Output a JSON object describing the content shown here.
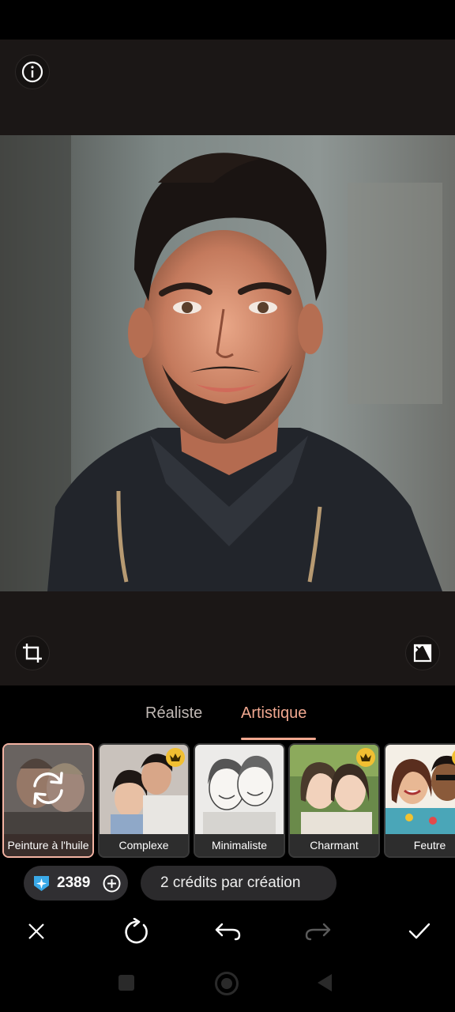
{
  "tabs": [
    {
      "label": "Réaliste",
      "active": false
    },
    {
      "label": "Artistique",
      "active": true
    }
  ],
  "styles": [
    {
      "label": "Peinture à l'huile",
      "selected": true,
      "premium": false
    },
    {
      "label": "Complexe",
      "selected": false,
      "premium": true
    },
    {
      "label": "Minimaliste",
      "selected": false,
      "premium": false
    },
    {
      "label": "Charmant",
      "selected": false,
      "premium": true
    },
    {
      "label": "Feutre",
      "selected": false,
      "premium": true
    }
  ],
  "credits": {
    "count": "2389",
    "info": "2 crédits par création"
  },
  "colors": {
    "accent": "#f1a890",
    "selected_border": "#f3b3a2",
    "crown": "#f1bf32",
    "gem": "#3aa9e8"
  },
  "icons": [
    "info-icon",
    "crop-icon",
    "compare-icon",
    "regenerate-icon",
    "close-icon",
    "refresh-icon",
    "undo-icon",
    "redo-icon",
    "check-icon",
    "crown-icon",
    "gem-icon",
    "add-icon"
  ]
}
